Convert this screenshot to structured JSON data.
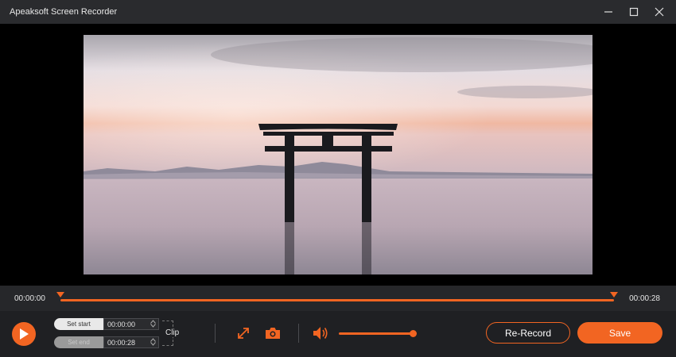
{
  "window": {
    "title": "Apeaksoft Screen Recorder",
    "controls": [
      "minimize-icon",
      "maximize-icon",
      "close-icon"
    ]
  },
  "player": {
    "preview": "video-frame-torii-gate-sunset",
    "time_start": "00:00:00",
    "time_end": "00:00:28",
    "progress_start_fraction": 0.0,
    "progress_end_fraction": 1.0
  },
  "clip": {
    "set_start_label": "Set start",
    "set_end_label": "Set end",
    "start_time": "00:00:00",
    "end_time": "00:00:28",
    "clip_label": "Clip"
  },
  "toolbar": {
    "play_icon": "play-icon",
    "trim_icon": "expand-icon",
    "snapshot_icon": "camera-icon",
    "volume_icon": "speaker-icon",
    "volume_level_fraction": 1.0,
    "rerecord_label": "Re-Record",
    "save_label": "Save"
  },
  "colors": {
    "accent": "#f26522",
    "background": "#1b1b1d",
    "titlebar": "#2a2b2e"
  }
}
